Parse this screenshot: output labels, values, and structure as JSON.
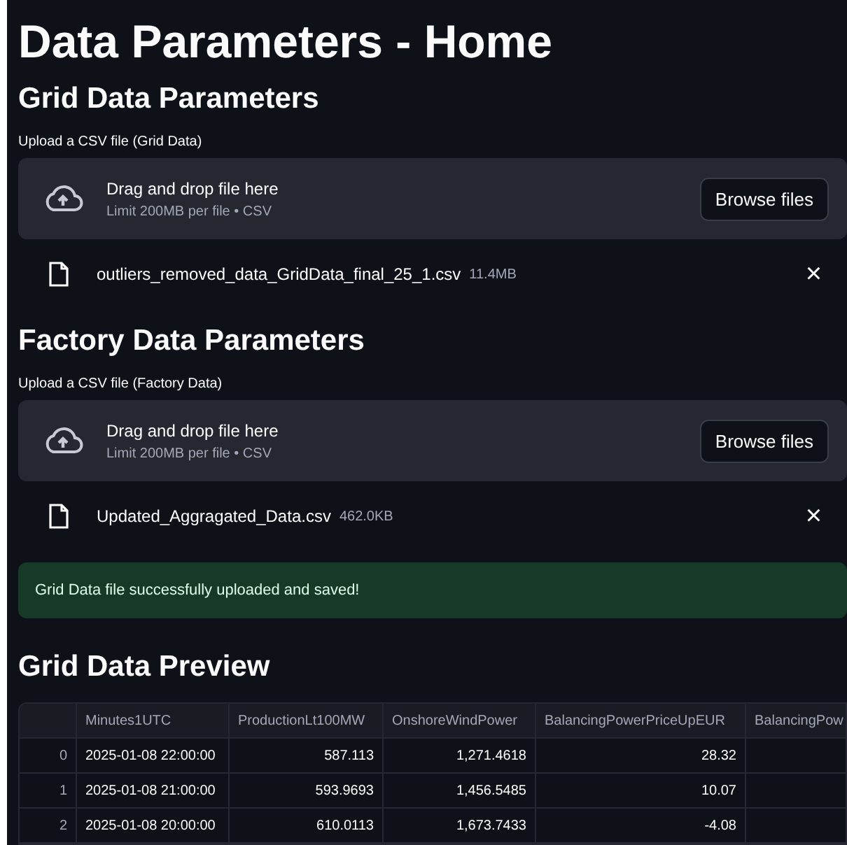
{
  "title": "Data Parameters - Home",
  "uploaders": [
    {
      "heading": "Grid Data Parameters",
      "label": "Upload a CSV file (Grid Data)",
      "drop_text": "Drag and drop file here",
      "limit": "Limit 200MB per file • CSV",
      "button": "Browse files",
      "file": {
        "name": "outliers_removed_data_GridData_final_25_1.csv",
        "size": "11.4MB",
        "close": "×"
      }
    },
    {
      "heading": "Factory Data Parameters",
      "label": "Upload a CSV file (Factory Data)",
      "drop_text": "Drag and drop file here",
      "limit": "Limit 200MB per file • CSV",
      "button": "Browse files",
      "file": {
        "name": "Updated_Aggragated_Data.csv",
        "size": "462.0KB",
        "close": "×"
      }
    }
  ],
  "success": "Grid Data file successfully uploaded and saved!",
  "preview": {
    "heading": "Grid Data Preview",
    "columns": [
      "",
      "Minutes1UTC",
      "ProductionLt100MW",
      "OnshoreWindPower",
      "BalancingPowerPriceUpEUR",
      "BalancingPow"
    ],
    "rows": [
      [
        "0",
        "2025-01-08 22:00:00",
        "587.113",
        "1,271.4618",
        "28.32",
        ""
      ],
      [
        "1",
        "2025-01-08 21:00:00",
        "593.9693",
        "1,456.5485",
        "10.07",
        ""
      ],
      [
        "2",
        "2025-01-08 20:00:00",
        "610.0113",
        "1,673.7433",
        "-4.08",
        ""
      ]
    ]
  }
}
